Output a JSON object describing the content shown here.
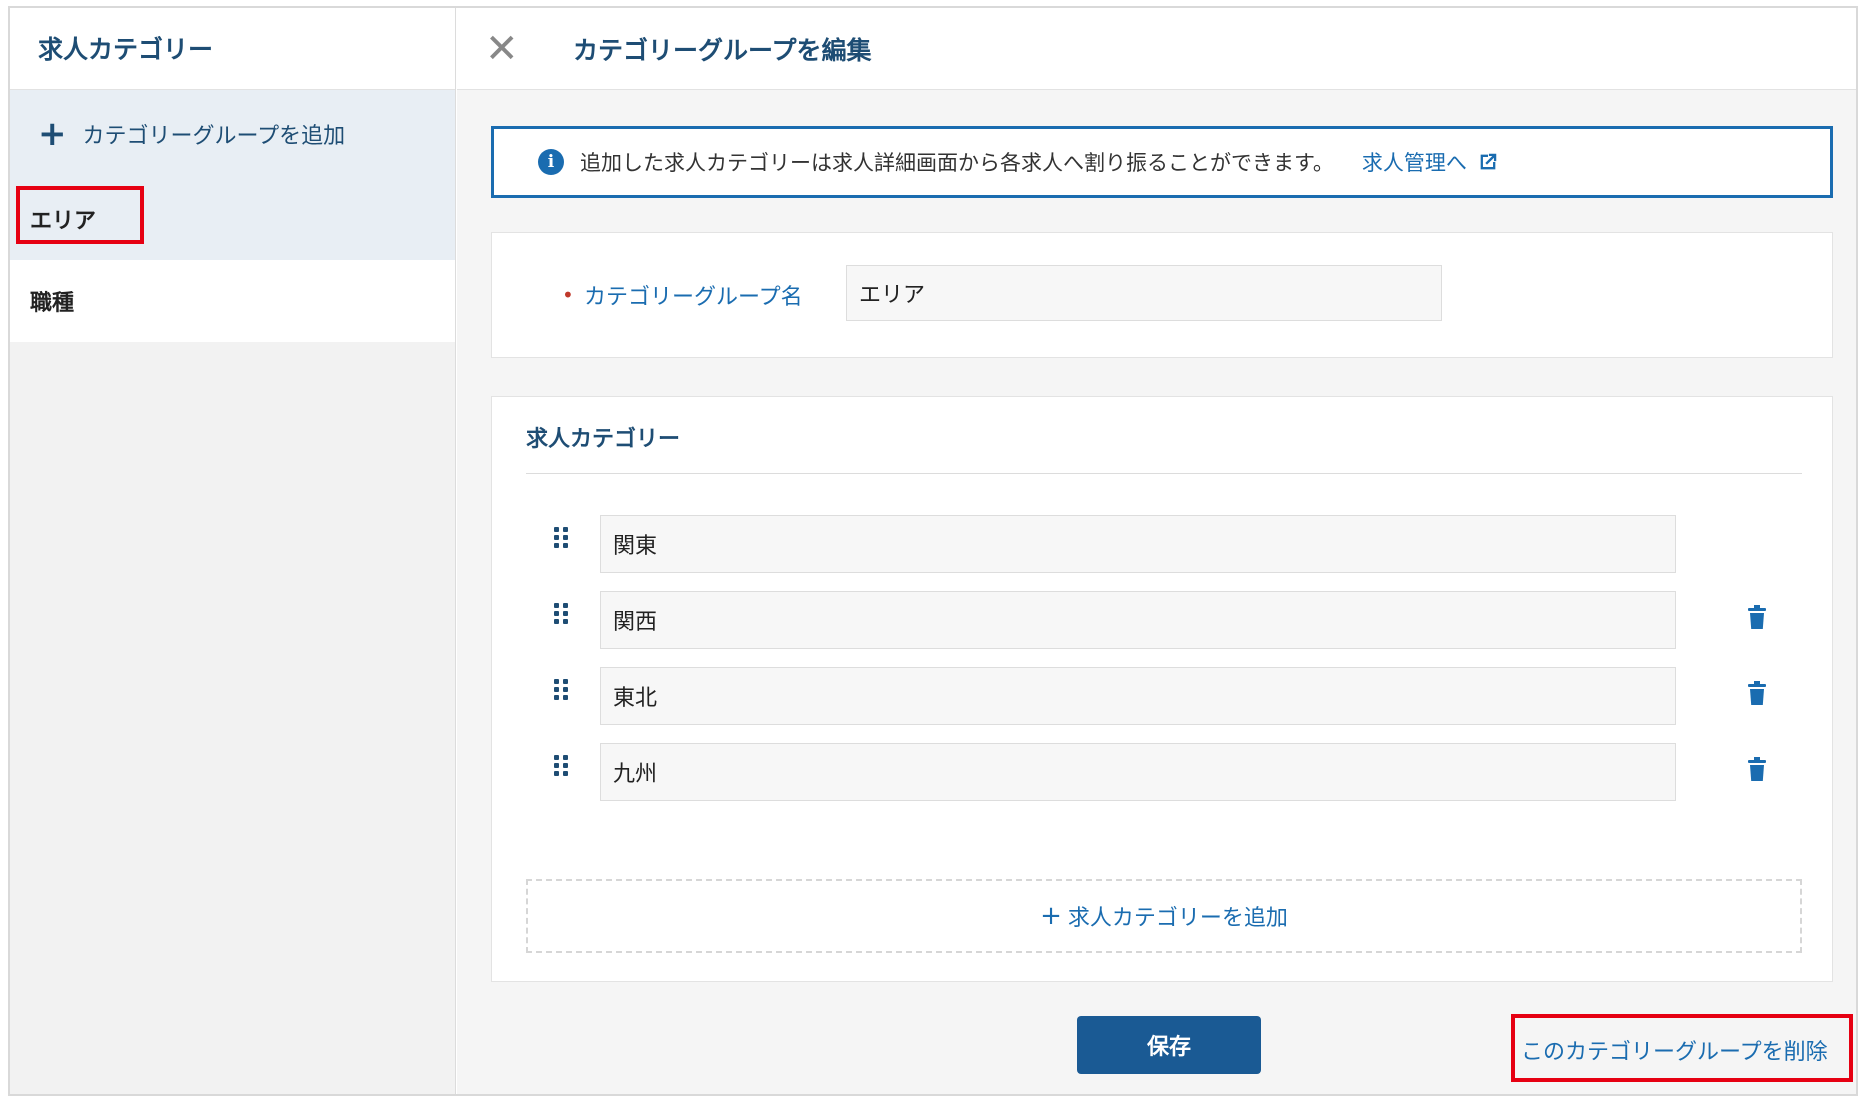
{
  "sidebar": {
    "title": "求人カテゴリー",
    "add_group_label": "カテゴリーグループを追加",
    "groups": [
      {
        "label": "エリア",
        "active": true
      },
      {
        "label": "職種",
        "active": false
      }
    ]
  },
  "header": {
    "title": "カテゴリーグループを編集",
    "close_icon": "close-icon"
  },
  "info": {
    "text": "追加した求人カテゴリーは求人詳細画面から各求人へ割り振ることができます。",
    "link_label": "求人管理へ",
    "icon": "info-icon"
  },
  "group_name": {
    "label": "カテゴリーグループ名",
    "value": "エリア",
    "required": true
  },
  "categories": {
    "title": "求人カテゴリー",
    "items": [
      {
        "value": "関東",
        "deletable": false
      },
      {
        "value": "関西",
        "deletable": true
      },
      {
        "value": "東北",
        "deletable": true
      },
      {
        "value": "九州",
        "deletable": true
      }
    ],
    "add_label": "求人カテゴリーを追加"
  },
  "actions": {
    "save_label": "保存",
    "delete_label": "このカテゴリーグループを削除"
  },
  "colors": {
    "accent": "#1a6cb0",
    "heading": "#1e4d74",
    "primary_button": "#1a5a94",
    "highlight": "#e60012"
  }
}
